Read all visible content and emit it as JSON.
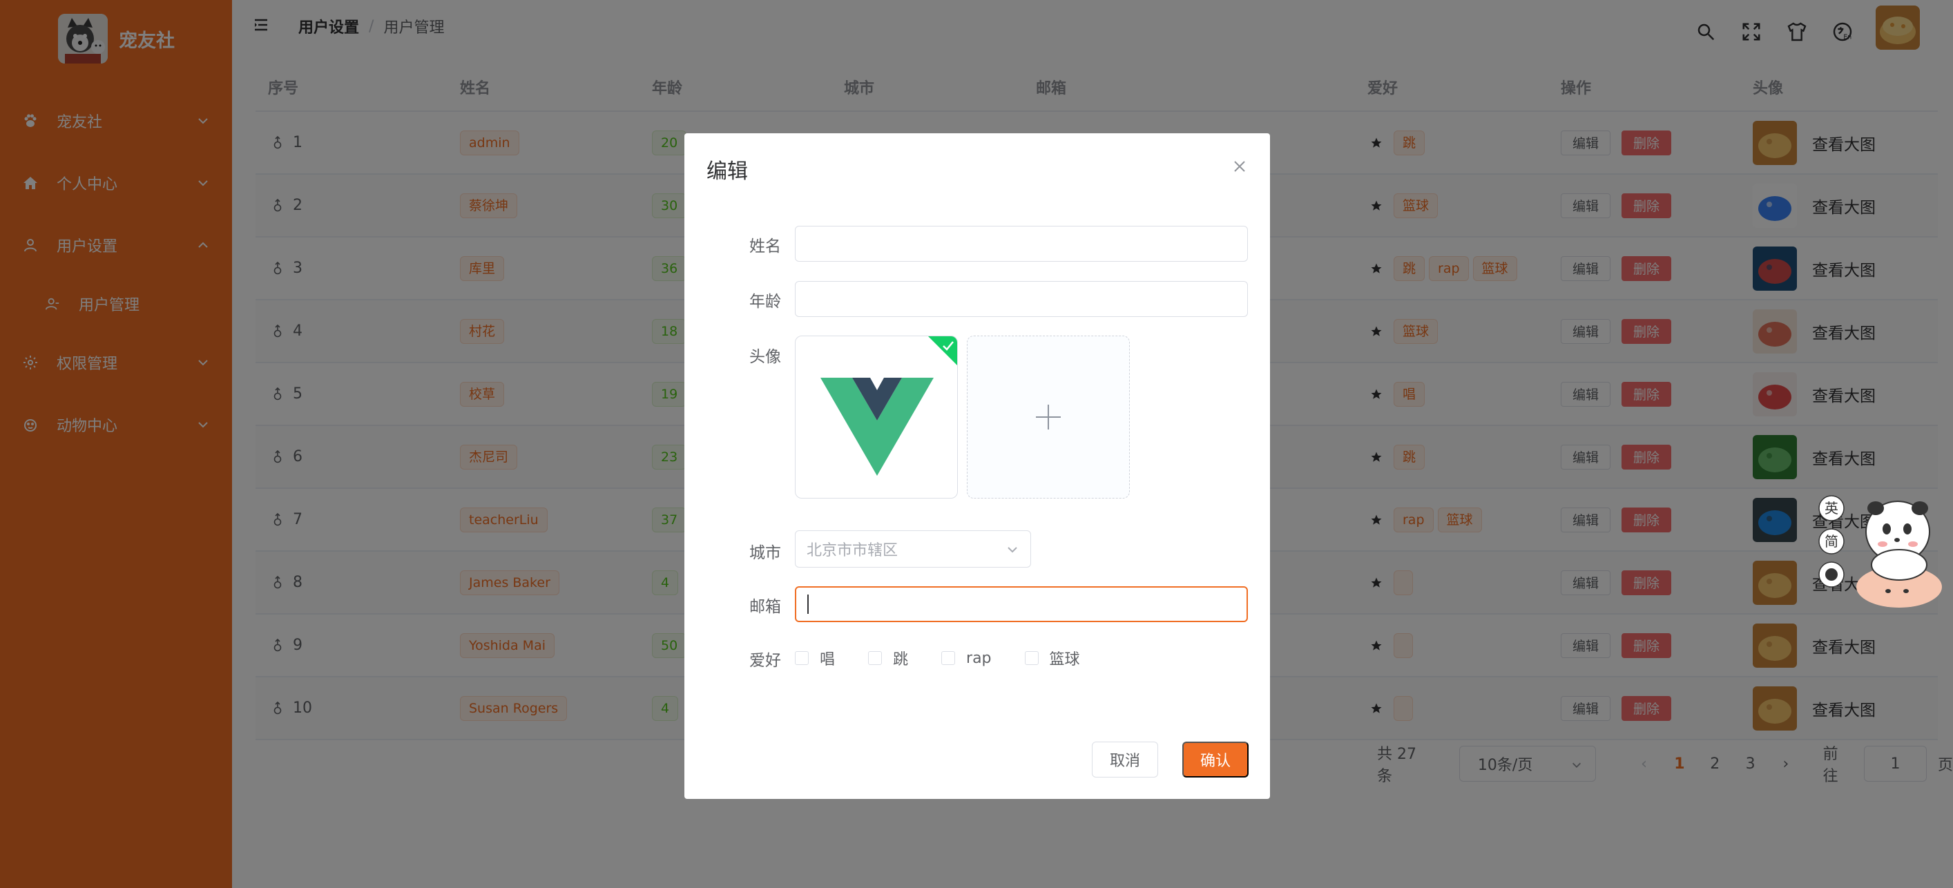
{
  "brand": {
    "name": "宠友社"
  },
  "sidebar": {
    "items": [
      {
        "label": "宠友社",
        "icon": "paw-icon",
        "expanded": false
      },
      {
        "label": "个人中心",
        "icon": "home-icon",
        "expanded": false
      },
      {
        "label": "用户设置",
        "icon": "user-icon",
        "expanded": true
      },
      {
        "label": "用户管理",
        "icon": "user-manage-icon",
        "sub": true
      },
      {
        "label": "权限管理",
        "icon": "gear-icon",
        "expanded": false
      },
      {
        "label": "动物中心",
        "icon": "animal-icon",
        "expanded": false
      }
    ]
  },
  "header": {
    "breadcrumb": [
      "用户设置",
      "用户管理"
    ],
    "breadcrumb_separator": "/",
    "icons": [
      "search-icon",
      "fullscreen-icon",
      "theme-shirt-icon",
      "language-icon"
    ]
  },
  "table": {
    "columns": [
      "序号",
      "姓名",
      "年龄",
      "城市",
      "邮箱",
      "爱好",
      "操作",
      "头像"
    ],
    "edit_label": "编辑",
    "delete_label": "删除",
    "view_label": "查看大图",
    "rows": [
      {
        "index": "1",
        "name": "admin",
        "age": "20",
        "hobbies": [
          "跳"
        ]
      },
      {
        "index": "2",
        "name": "蔡徐坤",
        "age": "30",
        "hobbies": [
          "篮球"
        ]
      },
      {
        "index": "3",
        "name": "库里",
        "age": "36",
        "hobbies": [
          "跳",
          "rap",
          "篮球"
        ]
      },
      {
        "index": "4",
        "name": "村花",
        "age": "18",
        "hobbies": [
          "篮球"
        ]
      },
      {
        "index": "5",
        "name": "校草",
        "age": "19",
        "hobbies": [
          "唱"
        ]
      },
      {
        "index": "6",
        "name": "杰尼司",
        "age": "23",
        "hobbies": [
          "跳"
        ]
      },
      {
        "index": "7",
        "name": "teacherLiu",
        "age": "37",
        "hobbies": [
          "rap",
          "篮球"
        ]
      },
      {
        "index": "8",
        "name": "James Baker",
        "age": "4",
        "hobbies": []
      },
      {
        "index": "9",
        "name": "Yoshida Mai",
        "age": "50",
        "hobbies": []
      },
      {
        "index": "10",
        "name": "Susan Rogers",
        "age": "4",
        "hobbies": []
      }
    ]
  },
  "pagination": {
    "total": "共 27 条",
    "page_size": "10条/页",
    "pages": [
      "1",
      "2",
      "3"
    ],
    "current": "1",
    "goto_prefix": "前往",
    "goto_value": "1",
    "goto_suffix": "页"
  },
  "dialog": {
    "title": "编辑",
    "fields": {
      "name_label": "姓名",
      "name_value": "",
      "age_label": "年龄",
      "age_value": "",
      "avatar_label": "头像",
      "city_label": "城市",
      "city_placeholder": "北京市市辖区",
      "email_label": "邮箱",
      "email_value": "",
      "hobby_label": "爱好",
      "hobby_options": [
        "唱",
        "跳",
        "rap",
        "篮球"
      ]
    },
    "cancel_label": "取消",
    "confirm_label": "确认"
  },
  "mascot": {
    "labels": [
      "英",
      "简"
    ]
  },
  "colors": {
    "accent": "#f06e24",
    "danger": "#f56c6c",
    "success": "#52c41a"
  }
}
